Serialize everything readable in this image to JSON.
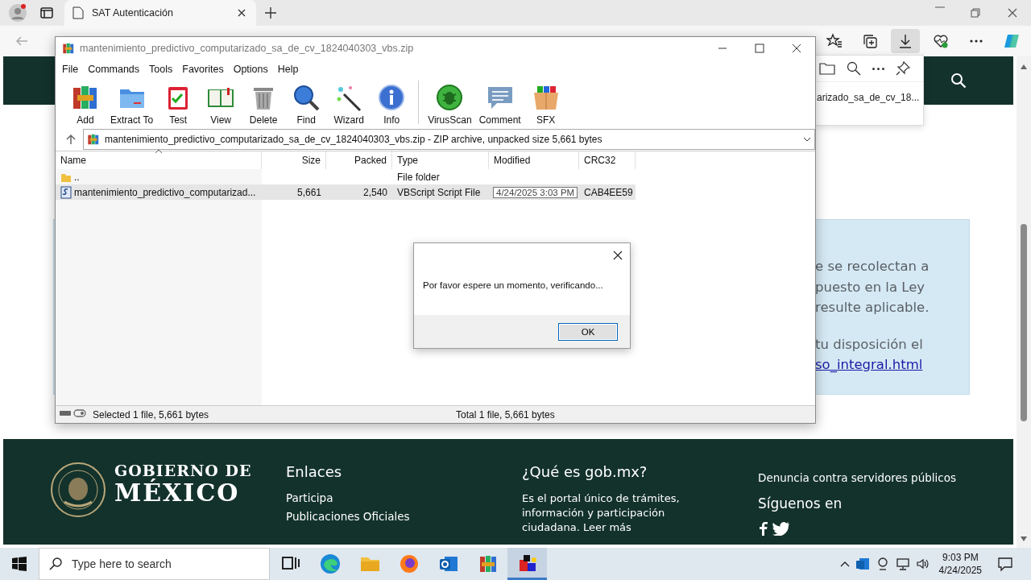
{
  "browser": {
    "tab": {
      "title": "SAT Autenticación",
      "selected": true
    },
    "downloads_open": true
  },
  "page": {
    "info_box": {
      "lines": [
        "e se recolectan a",
        "puesto en la Ley",
        "resulte aplicable.",
        "tu disposición el"
      ],
      "link": "so_integral.html"
    },
    "footer": {
      "logo_line1": "GOBIERNO DE",
      "logo_line2": "MÉXICO",
      "links_title": "Enlaces",
      "links": [
        "Participa",
        "Publicaciones Oficiales"
      ],
      "about_title": "¿Qué es gob.mx?",
      "about_text": "Es el portal único de trámites, información y participación ciudadana.",
      "about_link": "Leer más",
      "report": "Denuncia contra servidores públicos",
      "follow": "Síguenos en"
    }
  },
  "downloads": {
    "item": "arizado_sa_de_cv_18..."
  },
  "winrar": {
    "title": "mantenimiento_predictivo_computarizado_sa_de_cv_1824040303_vbs.zip",
    "menu": [
      "File",
      "Commands",
      "Tools",
      "Favorites",
      "Options",
      "Help"
    ],
    "toolbar": [
      [
        {
          "label": "Add"
        },
        {
          "label": "Extract To"
        },
        {
          "label": "Test"
        },
        {
          "label": "View"
        },
        {
          "label": "Delete"
        },
        {
          "label": "Find"
        },
        {
          "label": "Wizard"
        },
        {
          "label": "Info"
        }
      ],
      [
        {
          "label": "VirusScan"
        },
        {
          "label": "Comment"
        },
        {
          "label": "SFX"
        }
      ]
    ],
    "path": "mantenimiento_predictivo_computarizado_sa_de_cv_1824040303_vbs.zip - ZIP archive, unpacked size 5,661 bytes",
    "columns": [
      {
        "label": "Name",
        "sorted": true
      },
      {
        "label": "Size",
        "sorted": false
      },
      {
        "label": "Packed",
        "sorted": false
      },
      {
        "label": "Type",
        "sorted": false
      },
      {
        "label": "Modified",
        "sorted": false
      },
      {
        "label": "CRC32",
        "sorted": false
      }
    ],
    "rows": [
      {
        "kind": "folder",
        "name": "..",
        "type": "File folder",
        "selected": false
      },
      {
        "kind": "file",
        "name": "mantenimiento_predictivo_computarizad...",
        "size": "5,661",
        "packed": "2,540",
        "type": "VBScript Script File",
        "modified": "4/24/2025 3:03 PM",
        "crc32": "CAB4EE59",
        "selected": true
      }
    ],
    "status": {
      "selected": "Selected 1 file, 5,661 bytes",
      "total": "Total 1 file, 5,661 bytes"
    }
  },
  "dialog": {
    "message": "Por favor espere un momento, verificando...",
    "button": "OK"
  },
  "taskbar": {
    "search_placeholder": "Type here to search",
    "apps": [
      {
        "active": false
      },
      {
        "active": false
      },
      {
        "active": false
      },
      {
        "active": false
      },
      {
        "active": false
      },
      {
        "active": false
      },
      {
        "active": true
      }
    ],
    "time": "9:03 PM",
    "date": "4/24/2025"
  }
}
